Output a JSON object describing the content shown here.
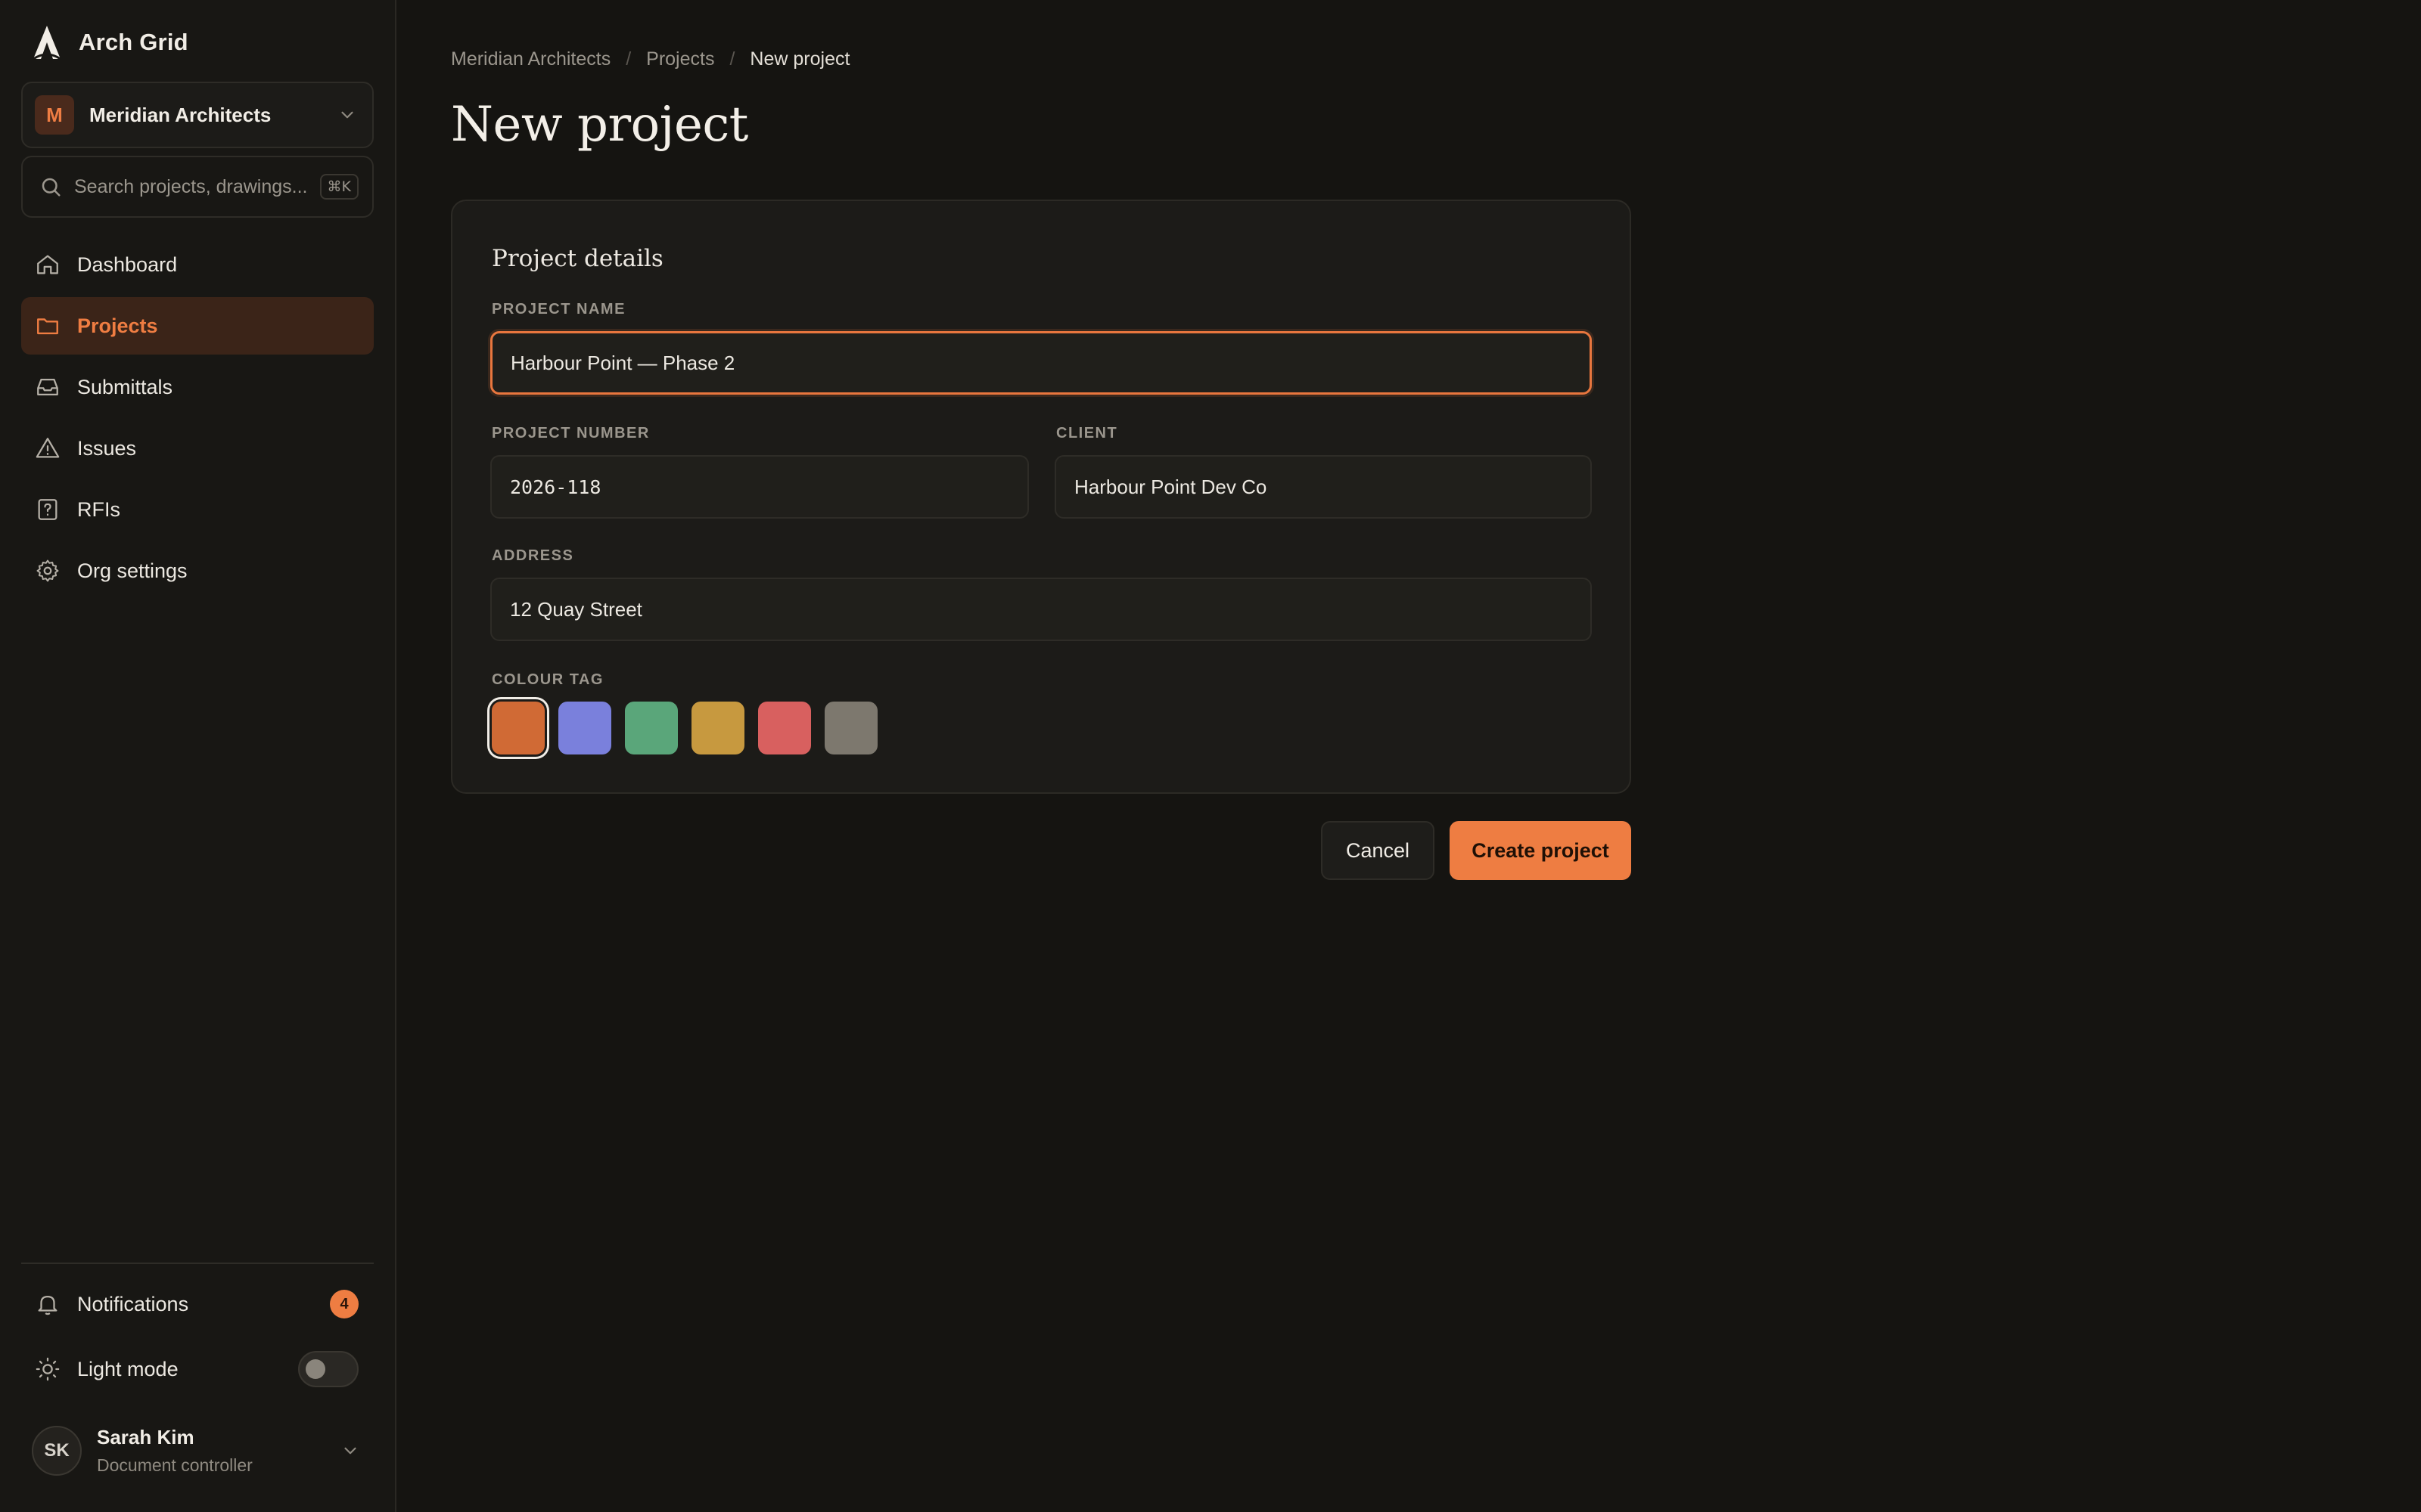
{
  "app": {
    "name": "Arch Grid"
  },
  "org": {
    "initial": "M",
    "name": "Meridian Architects"
  },
  "search": {
    "placeholder": "Search projects, drawings...",
    "shortcut": "⌘K"
  },
  "nav": {
    "items": [
      {
        "label": "Dashboard",
        "icon": "home-icon"
      },
      {
        "label": "Projects",
        "icon": "folder-icon",
        "active": true
      },
      {
        "label": "Submittals",
        "icon": "inbox-icon"
      },
      {
        "label": "Issues",
        "icon": "warning-icon"
      },
      {
        "label": "RFIs",
        "icon": "question-icon"
      },
      {
        "label": "Org settings",
        "icon": "gear-icon"
      }
    ]
  },
  "footer": {
    "notifications": {
      "label": "Notifications",
      "count": "4"
    },
    "light_mode": {
      "label": "Light mode",
      "enabled": false
    },
    "user": {
      "initials": "SK",
      "name": "Sarah Kim",
      "role": "Document controller"
    }
  },
  "breadcrumb": [
    "Meridian Architects",
    "Projects",
    "New project"
  ],
  "page": {
    "title": "New project"
  },
  "form": {
    "section_title": "Project details",
    "project_name": {
      "label": "PROJECT NAME",
      "value": "Harbour Point — Phase 2"
    },
    "project_number": {
      "label": "PROJECT NUMBER",
      "value": "2026-118"
    },
    "client": {
      "label": "CLIENT",
      "value": "Harbour Point Dev Co"
    },
    "address": {
      "label": "ADDRESS",
      "value": "12 Quay Street"
    },
    "colour_tag": {
      "label": "COLOUR TAG",
      "options": [
        "#d06a35",
        "#7a80dc",
        "#5aa67a",
        "#c7993f",
        "#d8605f",
        "#7d786e"
      ],
      "selected": 0
    }
  },
  "actions": {
    "cancel": "Cancel",
    "create": "Create project"
  },
  "colors": {
    "accent": "#ee7d42",
    "background": "#151411",
    "sidebar": "#181714"
  }
}
